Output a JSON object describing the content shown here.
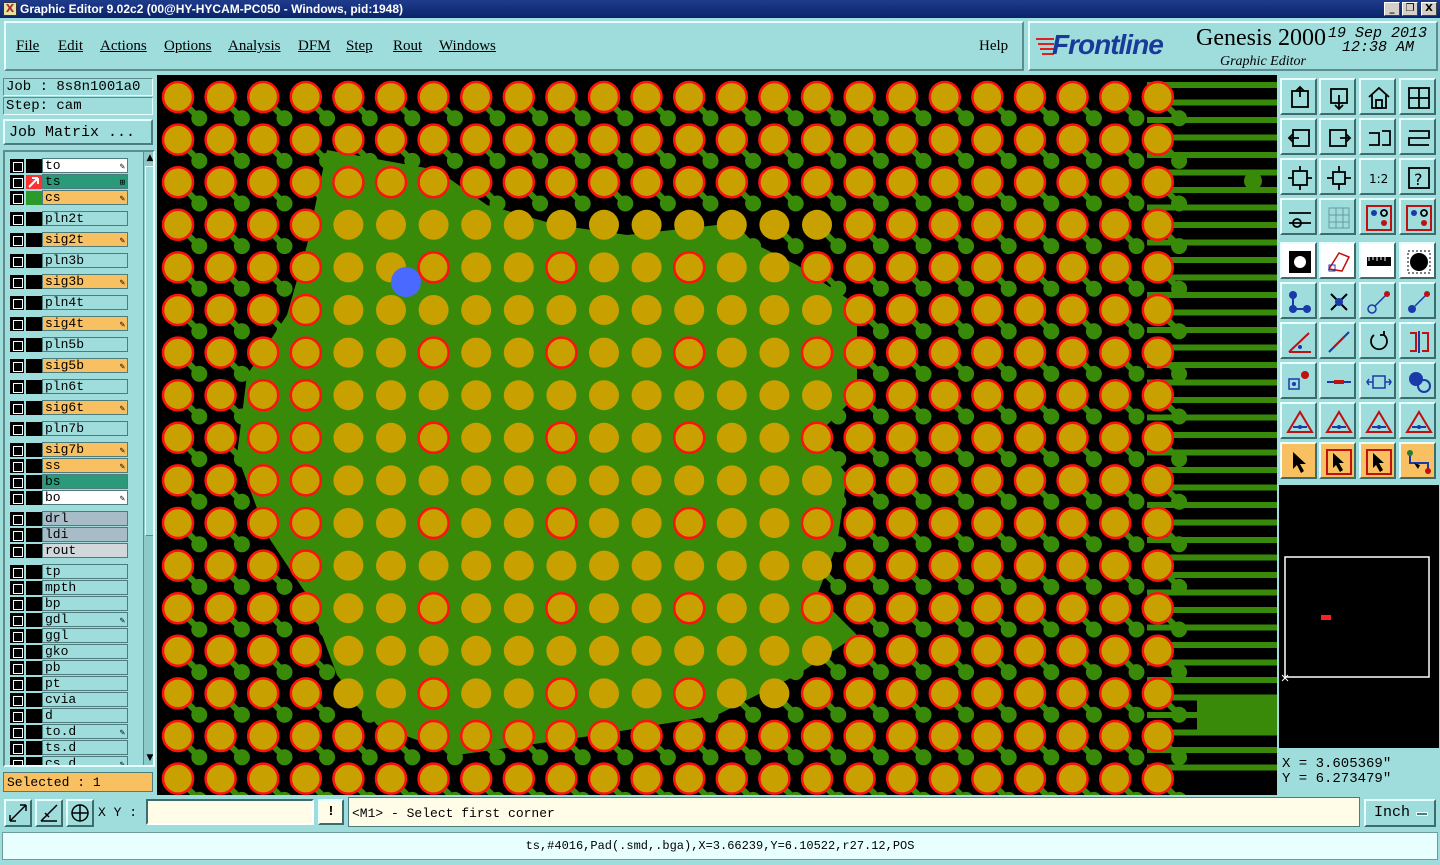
{
  "window": {
    "title": "Graphic Editor 9.02c2 (00@HY-HYCAM-PC050 - Windows, pid:1948)",
    "icon": "X",
    "min_glyph": "_",
    "max_glyph": "❐",
    "close_glyph": "X"
  },
  "menu": {
    "items": [
      "File",
      "Edit",
      "Actions",
      "Options",
      "Analysis",
      "DFM",
      "Step",
      "Rout",
      "Windows"
    ],
    "help": "Help"
  },
  "brand": {
    "logo": "Frontline",
    "product": "Genesis 2000",
    "subtitle": "Graphic Editor",
    "date": "19 Sep 2013",
    "time": "12:38 AM"
  },
  "job": {
    "job_line": "Job : 8s8n1001a0",
    "step_line": "Step: cam",
    "matrix_button": "Job Matrix ..."
  },
  "layers": [
    {
      "name": "to",
      "bg": "#ffffff",
      "mark": "✎",
      "col": "#000000"
    },
    {
      "name": "ts",
      "bg": "#2a9a7a",
      "mark": "⊞",
      "col": "#ff3030",
      "work": true
    },
    {
      "name": "cs",
      "bg": "#f8c060",
      "mark": "✎",
      "col": "#2a9a2a"
    },
    {
      "name": "pln2t",
      "bg": "#9fdcdc",
      "mark": "",
      "col": "#000000"
    },
    {
      "name": "sig2t",
      "bg": "#f8c060",
      "mark": "✎",
      "col": "#000000"
    },
    {
      "name": "pln3b",
      "bg": "#9fdcdc",
      "mark": "",
      "col": "#000000"
    },
    {
      "name": "sig3b",
      "bg": "#f8c060",
      "mark": "✎",
      "col": "#000000"
    },
    {
      "name": "pln4t",
      "bg": "#9fdcdc",
      "mark": "",
      "col": "#000000"
    },
    {
      "name": "sig4t",
      "bg": "#f8c060",
      "mark": "✎",
      "col": "#000000"
    },
    {
      "name": "pln5b",
      "bg": "#9fdcdc",
      "mark": "",
      "col": "#000000"
    },
    {
      "name": "sig5b",
      "bg": "#f8c060",
      "mark": "✎",
      "col": "#000000"
    },
    {
      "name": "pln6t",
      "bg": "#9fdcdc",
      "mark": "",
      "col": "#000000"
    },
    {
      "name": "sig6t",
      "bg": "#f8c060",
      "mark": "✎",
      "col": "#000000"
    },
    {
      "name": "pln7b",
      "bg": "#9fdcdc",
      "mark": "",
      "col": "#000000"
    },
    {
      "name": "sig7b",
      "bg": "#f8c060",
      "mark": "✎",
      "col": "#000000"
    },
    {
      "name": "ss",
      "bg": "#f8c060",
      "mark": "✎",
      "col": "#000000"
    },
    {
      "name": "bs",
      "bg": "#2a9a7a",
      "mark": "",
      "col": "#000000"
    },
    {
      "name": "bo",
      "bg": "#ffffff",
      "mark": "✎",
      "col": "#000000"
    },
    {
      "name": "drl",
      "bg": "#a8bcc8",
      "mark": "",
      "col": "#000000"
    },
    {
      "name": "ldi",
      "bg": "#a8bcc8",
      "mark": "",
      "col": "#000000"
    },
    {
      "name": "rout",
      "bg": "#d0d8dc",
      "mark": "",
      "col": "#000000"
    },
    {
      "name": "tp",
      "bg": "#9fdcdc",
      "mark": "",
      "col": "#000000"
    },
    {
      "name": "mpth",
      "bg": "#9fdcdc",
      "mark": "",
      "col": "#000000"
    },
    {
      "name": "bp",
      "bg": "#9fdcdc",
      "mark": "",
      "col": "#000000"
    },
    {
      "name": "gdl",
      "bg": "#9fdcdc",
      "mark": "✎",
      "col": "#000000"
    },
    {
      "name": "ggl",
      "bg": "#9fdcdc",
      "mark": "",
      "col": "#000000"
    },
    {
      "name": "gko",
      "bg": "#9fdcdc",
      "mark": "",
      "col": "#000000"
    },
    {
      "name": "pb",
      "bg": "#9fdcdc",
      "mark": "",
      "col": "#000000"
    },
    {
      "name": "pt",
      "bg": "#9fdcdc",
      "mark": "",
      "col": "#000000"
    },
    {
      "name": "cvia",
      "bg": "#9fdcdc",
      "mark": "",
      "col": "#000000"
    },
    {
      "name": "d",
      "bg": "#9fdcdc",
      "mark": "",
      "col": "#000000"
    },
    {
      "name": "to.d",
      "bg": "#9fdcdc",
      "mark": "✎",
      "col": "#000000"
    },
    {
      "name": "ts.d",
      "bg": "#9fdcdc",
      "mark": "",
      "col": "#000000"
    },
    {
      "name": "cs.d",
      "bg": "#9fdcdc",
      "mark": "✎",
      "col": "#000000"
    }
  ],
  "selected": "Selected : 1",
  "toolbox": {
    "icons": [
      "move-up-icon",
      "move-down-icon",
      "home-icon",
      "window-icon",
      "pan-left-icon",
      "pan-right-icon",
      "swap-icon",
      "snake-icon",
      "zoom-fit-icon",
      "zoom-center-icon",
      "scale-1-2-icon",
      "help-icon",
      "measure-icon",
      "grid-icon",
      "layer-red-icon",
      "layer-red2-icon",
      "pad-icon",
      "shape-icon",
      "ruler-icon",
      "circle-icon",
      "connect-icon",
      "cross-icon",
      "arrow-red-icon",
      "arrow-blue-icon",
      "line-angle-icon",
      "line-diag-icon",
      "rotate-icon",
      "mirror-icon",
      "pad-red-icon",
      "line-red-icon",
      "resize-icon",
      "blob-icon",
      "triangle1-icon",
      "triangle2-icon",
      "triangle3-icon",
      "triangle4-icon",
      "pointer-icon",
      "pointer-box-icon",
      "pointer-box2-icon",
      "route-icon"
    ],
    "scale_text": "1:2"
  },
  "coords": {
    "x": "X = 3.605369\"",
    "y": "Y = 6.273479\""
  },
  "bottom": {
    "xy_label": "X Y :",
    "xy_value": "",
    "bang": "!",
    "prompt": "<M1> - Select first corner",
    "units": "Inch"
  },
  "status": "ts,#4016,Pad(.smd,.bga),X=3.66239,Y=6.10522,r27.12,POS",
  "colors": {
    "canvas_bg": "#000000",
    "copper_green": "#3a8a0a",
    "pad_gold": "#c8a000",
    "pad_ring_red": "#ff1010",
    "selected_pad": "#4a6aff"
  }
}
